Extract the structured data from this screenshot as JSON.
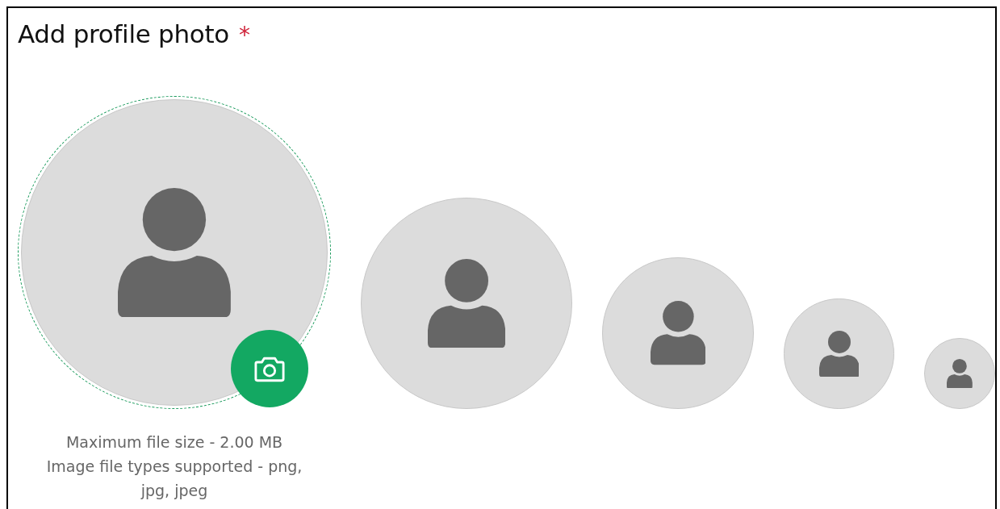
{
  "title": "Add profile photo",
  "required_mark": "*",
  "avatars": [
    {
      "kind": "upload"
    },
    {
      "kind": "preview"
    },
    {
      "kind": "preview"
    },
    {
      "kind": "preview"
    },
    {
      "kind": "preview"
    }
  ],
  "hints": [
    "Maximum file size - 2.00 MB",
    "Image file types supported - png, jpg, jpeg"
  ]
}
